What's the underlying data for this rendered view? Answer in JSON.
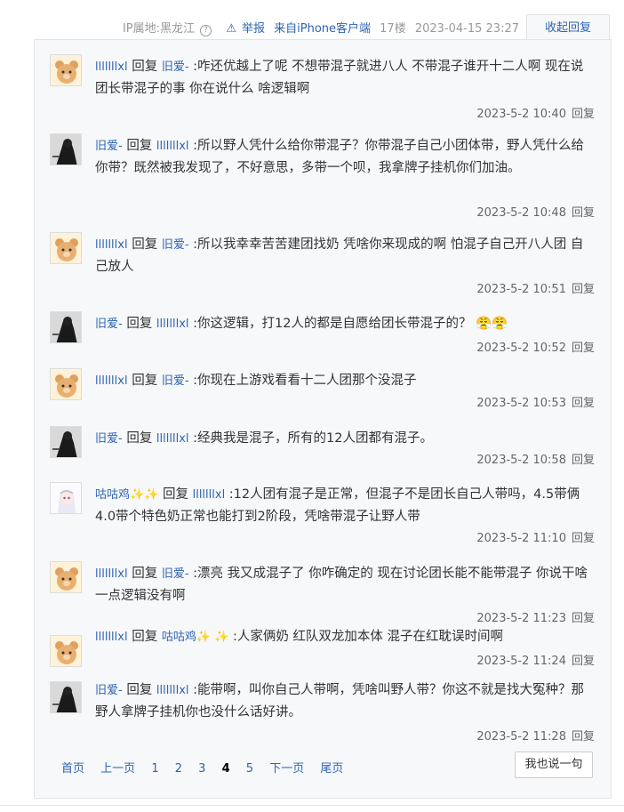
{
  "header": {
    "ip_location": "IP属地:黑龙江",
    "report": "举报",
    "source": "来自iPhone客户端",
    "floor": "17楼",
    "datetime": "2023-04-15 23:27",
    "collapse_label": "收起回复"
  },
  "replies": [
    {
      "user": "lllllllxl",
      "verb": "回复",
      "to": "旧爱-",
      "text": ":咋还优越上了呢 不想带混子就进八人 不带混子谁开十二人啊 现在说团长带混子的事 你在说什么 啥逻辑啊",
      "time": "2023-5-2 10:40",
      "reply_label": "回复",
      "avatar": "bear-avatar"
    },
    {
      "user": "旧爱-",
      "verb": "回复",
      "to": "lllllllxl",
      "text": ":所以野人凭什么给你带混子？你带混子自己小团体带，野人凭什么给你带？既然被我发现了，不好意思，多带一个呗，我拿牌子挂机你们加油。",
      "time": "2023-5-2 10:48",
      "reply_label": "回复",
      "avatar": "dark-figure-avatar"
    },
    {
      "user": "lllllllxl",
      "verb": "回复",
      "to": "旧爱-",
      "text": ":所以我幸幸苦苦建团找奶 凭啥你来现成的啊 怕混子自己开八人团 自己放人",
      "time": "2023-5-2 10:51",
      "reply_label": "回复",
      "avatar": "bear-avatar"
    },
    {
      "user": "旧爱-",
      "verb": "回复",
      "to": "lllllllxl",
      "text": ":你这逻辑，打12人的都是自愿给团长带混子的？",
      "time": "2023-5-2 10:52",
      "reply_label": "回复",
      "avatar": "dark-figure-avatar",
      "emoji": "😤😤"
    },
    {
      "user": "lllllllxl",
      "verb": "回复",
      "to": "旧爱-",
      "text": ":你现在上游戏看看十二人团那个没混子",
      "time": "2023-5-2 10:53",
      "reply_label": "回复",
      "avatar": "bear-avatar"
    },
    {
      "user": "旧爱-",
      "verb": "回复",
      "to": "lllllllxl",
      "text": ":经典我是混子，所有的12人团都有混子。",
      "time": "2023-5-2 10:58",
      "reply_label": "回复",
      "avatar": "dark-figure-avatar"
    },
    {
      "user": "咕咕鸡✨✨",
      "verb": "回复",
      "to": "lllllllxl",
      "text": ":12人团有混子是正常，但混子不是团长自己人带吗，4.5带俩4.0带个特色奶正常也能打到2阶段，凭啥带混子让野人带",
      "time": "2023-5-2 11:10",
      "reply_label": "回复",
      "avatar": "anime-girl-avatar"
    },
    {
      "user": "lllllllxl",
      "verb": "回复",
      "to": "旧爱-",
      "text": ":漂亮 我又成混子了 你咋确定的 现在讨论团长能不能带混子 你说干啥 一点逻辑没有啊",
      "time": "2023-5-2 11:23",
      "reply_label": "回复",
      "avatar": "bear-avatar"
    },
    {
      "user": "lllllllxl",
      "verb": "回复",
      "to": "咕咕鸡✨ ✨",
      "text": ":人家俩奶 红队双龙加本体 混子在红耽误时间啊",
      "time": "2023-5-2 11:24",
      "reply_label": "回复",
      "avatar": "bear-avatar"
    },
    {
      "user": "旧爱-",
      "verb": "回复",
      "to": "lllllllxl",
      "text": ":能带啊，叫你自己人带啊，凭啥叫野人带？你这不就是找大冤种？那野人拿牌子挂机你也没什么话好讲。",
      "time": "2023-5-2 11:28",
      "reply_label": "回复",
      "avatar": "dark-figure-avatar"
    }
  ],
  "pager": {
    "first": "首页",
    "prev": "上一页",
    "pages": [
      "1",
      "2",
      "3",
      "4",
      "5"
    ],
    "current": "4",
    "next": "下一页",
    "last": "尾页"
  },
  "say_button": "我也说一句",
  "colors": {
    "link": "#2d64b3",
    "panel": "#f7f8fa",
    "border": "#e1e4e8"
  }
}
